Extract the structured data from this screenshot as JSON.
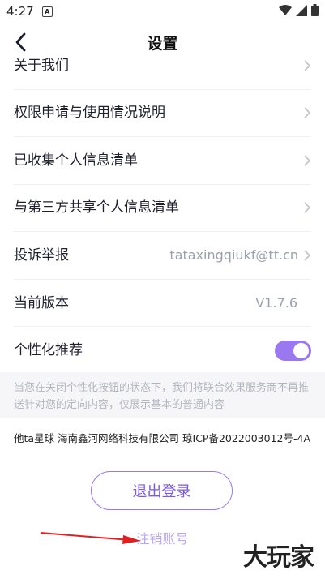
{
  "status_bar": {
    "time": "4:27",
    "app_icon_letter": "A"
  },
  "header": {
    "title": "设置",
    "back_icon": "chevron-left-icon"
  },
  "rows": [
    {
      "label": "关于我们"
    },
    {
      "label": "权限申请与使用情况说明"
    },
    {
      "label": "已收集个人信息清单"
    },
    {
      "label": "与第三方共享个人信息清单"
    },
    {
      "label": "投诉举报",
      "value": "tataxingqiukf@tt.cn"
    },
    {
      "label": "当前版本",
      "value": "V1.7.6"
    },
    {
      "label": "个性化推荐",
      "toggle_on": true
    }
  ],
  "notice": "当您在关闭个性化按钮的状态下，我们将联合效果服务商不再推送针对您的定向内容，仅展示基本的普通内容",
  "company_info": "他ta星球 海南鑫河网络科技有限公司 琼ICP备2022003012号-4A",
  "buttons": {
    "logout": "退出登录",
    "cancel_account": "注销账号"
  },
  "watermark": "大玩家",
  "colors": {
    "accent": "#9a78f0",
    "accent_text": "#7c58e6",
    "muted": "#9aa0ad",
    "annotation_arrow": "#e02020"
  }
}
